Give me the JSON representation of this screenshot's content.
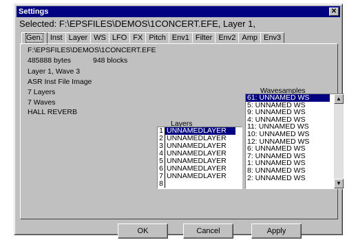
{
  "window": {
    "title": "Settings",
    "close_glyph": "✕",
    "selected_line": "Selected: F:\\EPSFILES\\DEMOS\\1CONCERT.EFE, Layer 1,"
  },
  "tabs": [
    "Gen.",
    "Inst",
    "Layer",
    "WS",
    "LFO",
    "FX",
    "Pitch",
    "Env1",
    "Filter",
    "Env2",
    "Amp",
    "Env3"
  ],
  "info": {
    "path": "F:\\EPSFILES\\DEMOS\\1CONCERT.EFE",
    "bytes": "485888 bytes",
    "blocks": "948 blocks",
    "layer_wave": "Layer 1, Wave 3",
    "file_type": "ASR Inst File Image",
    "layers_count": "7 Layers",
    "waves_count": "7 Waves",
    "effect": " HALL REVERB"
  },
  "layers": {
    "label": "Layers",
    "rows": [
      {
        "num": "1",
        "name": "UNNAMEDLAYER"
      },
      {
        "num": "2",
        "name": "UNNAMEDLAYER"
      },
      {
        "num": "3",
        "name": "UNNAMEDLAYER"
      },
      {
        "num": "4",
        "name": "UNNAMEDLAYER"
      },
      {
        "num": "5",
        "name": "UNNAMEDLAYER"
      },
      {
        "num": "6",
        "name": "UNNAMEDLAYER"
      },
      {
        "num": "7",
        "name": "UNNAMEDLAYER"
      },
      {
        "num": "8",
        "name": ""
      }
    ]
  },
  "wavesamples": {
    "label": "Wavesamples",
    "items": [
      "61: UNNAMED WS",
      "5: UNNAMED WS",
      "9: UNNAMED WS",
      "4: UNNAMED WS",
      "11: UNNAMED WS",
      "10: UNNAMED WS",
      "12: UNNAMED WS",
      "6: UNNAMED WS",
      "7: UNNAMED WS",
      "1: UNNAMED WS",
      "8: UNNAMED WS",
      "2: UNNAMED WS"
    ]
  },
  "buttons": {
    "ok": "OK",
    "cancel": "Cancel",
    "apply": "Apply"
  },
  "icons": {
    "scroll_up": "▲",
    "scroll_down": "▼"
  }
}
